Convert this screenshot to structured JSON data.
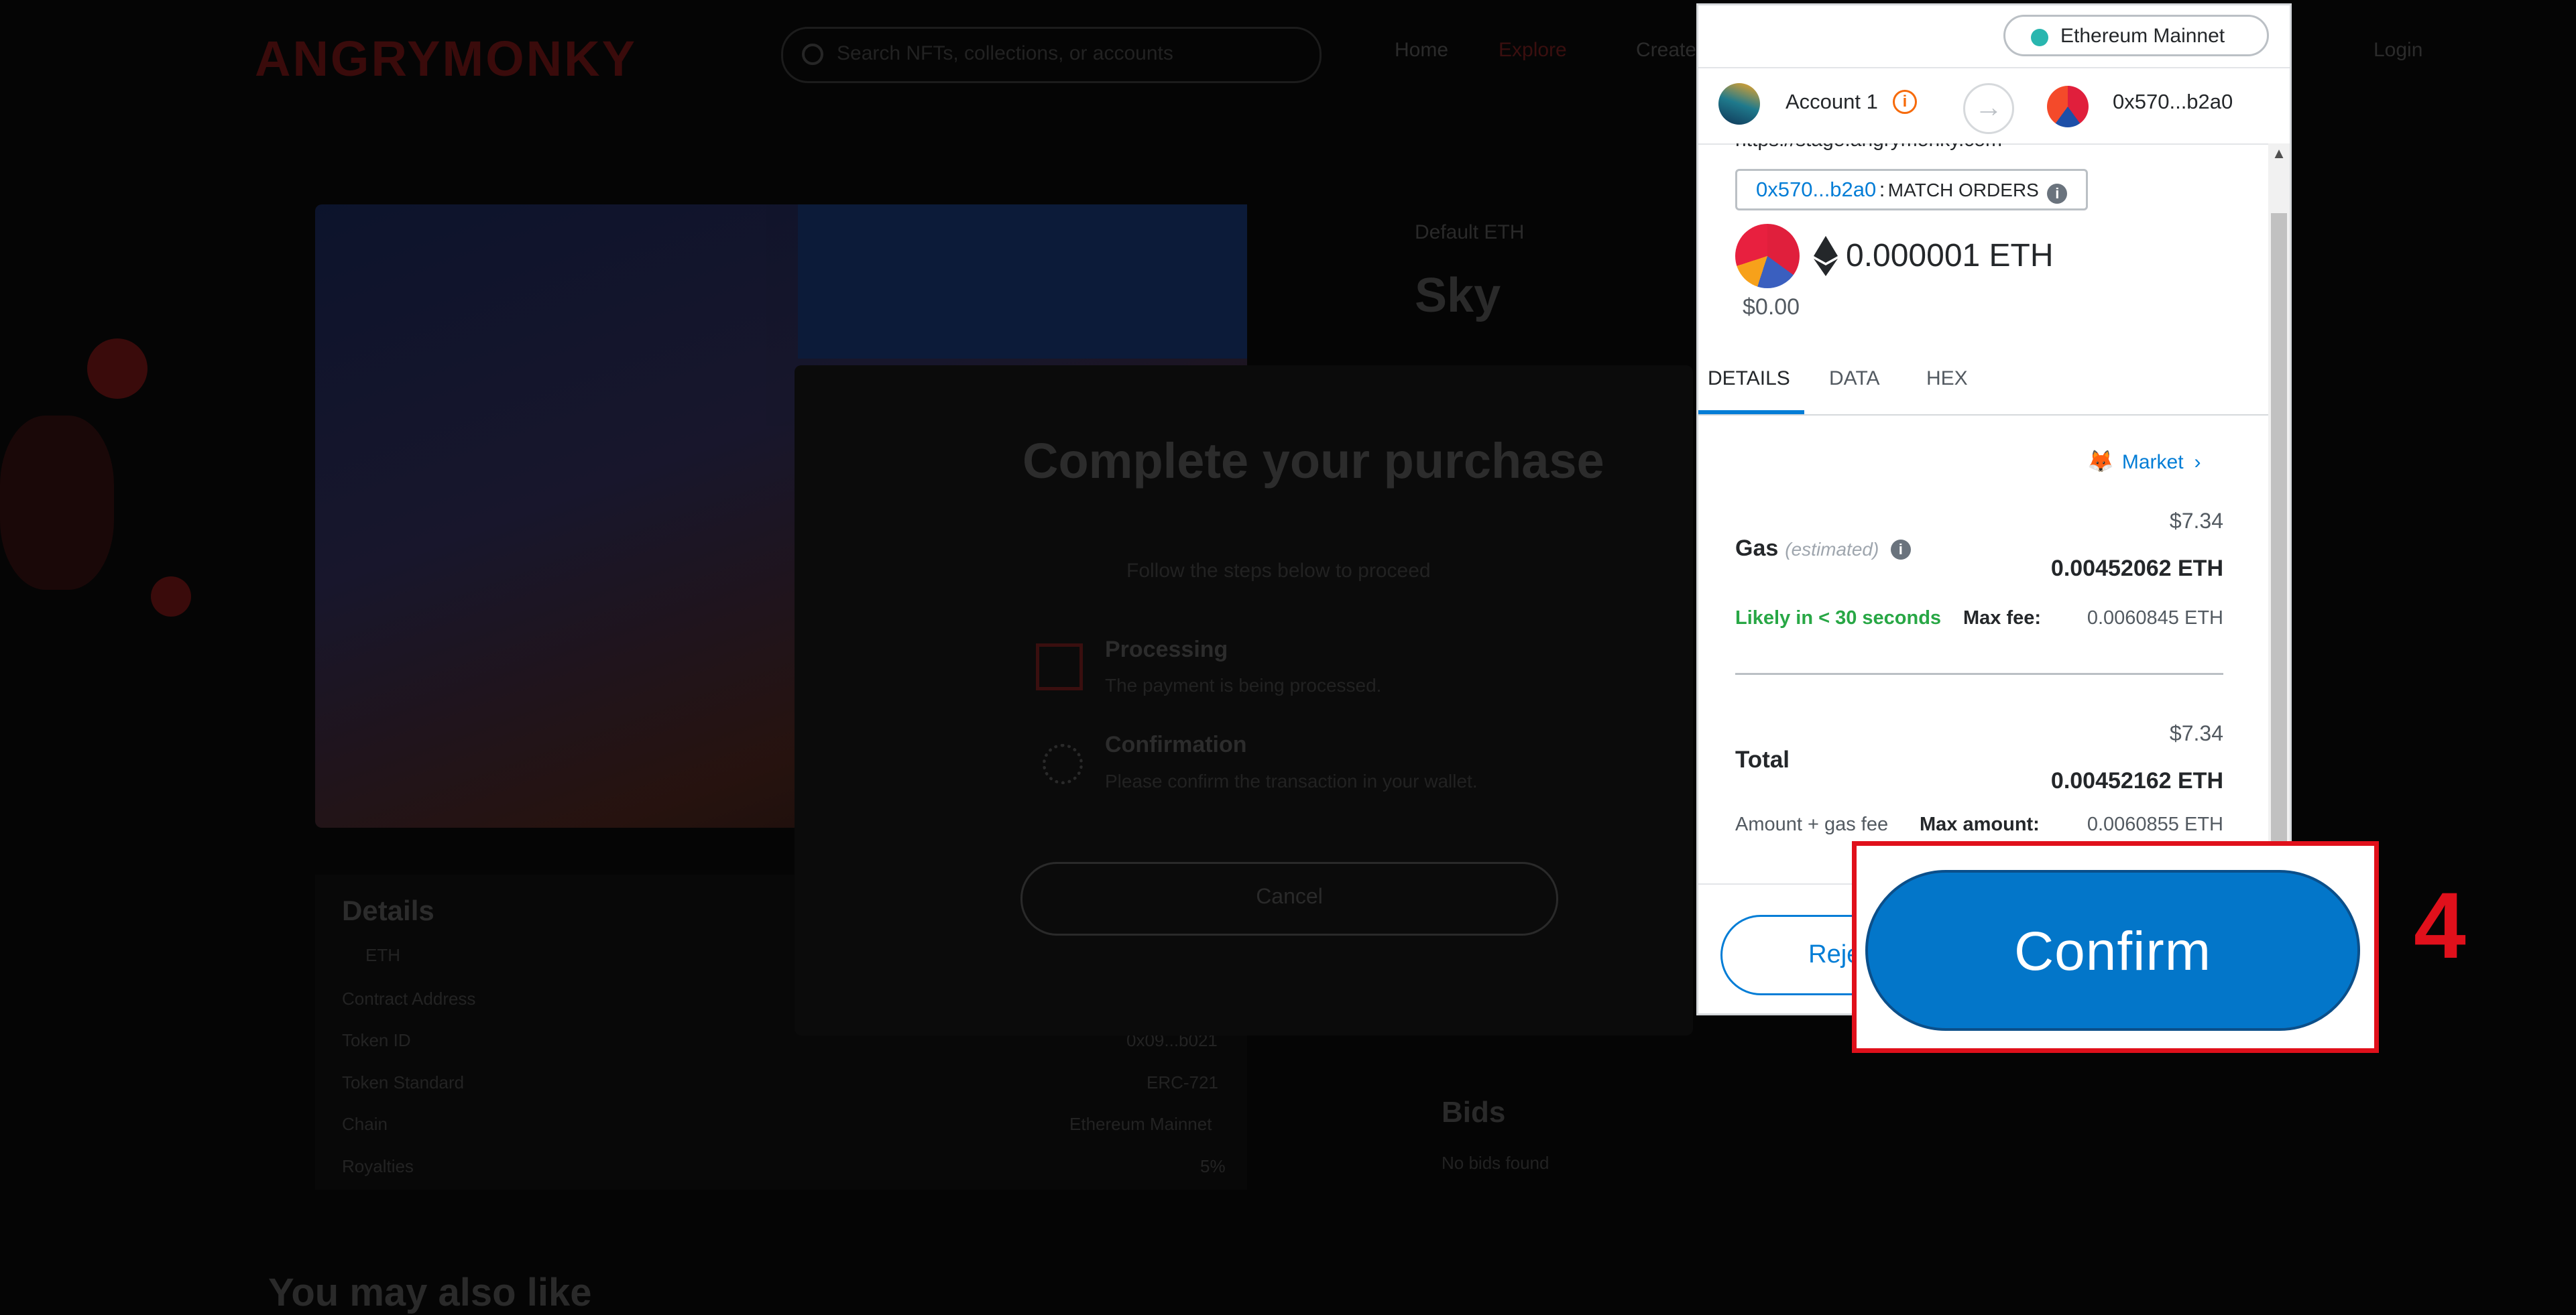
{
  "background": {
    "logo": "ANGRYMONKY",
    "search_placeholder": "Search NFTs, collections, or accounts",
    "nav": [
      "Home",
      "Explore",
      "Create",
      "Login"
    ],
    "item_label": "Default ETH",
    "item_title": "Sky",
    "modal": {
      "title": "Complete your purchase",
      "subtitle": "Follow the steps below to proceed",
      "steps": [
        {
          "title": "Processing",
          "desc": "The payment is being processed."
        },
        {
          "title": "Confirmation",
          "desc": "Please confirm the transaction in your wallet."
        }
      ],
      "cancel_label": "Cancel"
    },
    "details": {
      "heading": "Details",
      "rows": [
        "ETH",
        "Contract Address",
        "Token ID",
        "Token Standard",
        "Chain",
        "Royalties"
      ],
      "values": [
        "",
        "",
        "0x09...b021",
        "ERC-721",
        "Ethereum Mainnet",
        "5%"
      ]
    },
    "bids_heading": "Bids",
    "bids_sub": "No bids found",
    "may_like": "You may also like"
  },
  "metamask": {
    "network": "Ethereum Mainnet",
    "account_name": "Account 1",
    "to_address": "0x570...b2a0",
    "origin": "https://stage.angrymonky.com",
    "method_address": "0x570...b2a0",
    "method_sep": ":",
    "method_name": "MATCH ORDERS",
    "value_eth": "0.000001 ETH",
    "value_usd": "$0.00",
    "tabs": [
      "DETAILS",
      "DATA",
      "HEX"
    ],
    "active_tab": "DETAILS",
    "market_label": "Market",
    "gas": {
      "label": "Gas",
      "estimated": "(estimated)",
      "usd": "$7.34",
      "eth": "0.00452062 ETH",
      "likely": "Likely in < 30 seconds",
      "max_fee_label": "Max fee:",
      "max_fee_value": "0.0060845 ETH"
    },
    "total": {
      "label": "Total",
      "usd": "$7.34",
      "eth": "0.00452162 ETH",
      "amount_gas": "Amount + gas fee",
      "max_amount_label": "Max amount:",
      "max_amount_value": "0.0060855 ETH"
    },
    "reject_label": "Reject",
    "confirm_label": "Confirm"
  },
  "callout": {
    "step_number": "4",
    "highlight_color": "#e0101b"
  },
  "colors": {
    "accent": "#037dd6",
    "success": "#28a745",
    "warning": "#f66a0a"
  }
}
